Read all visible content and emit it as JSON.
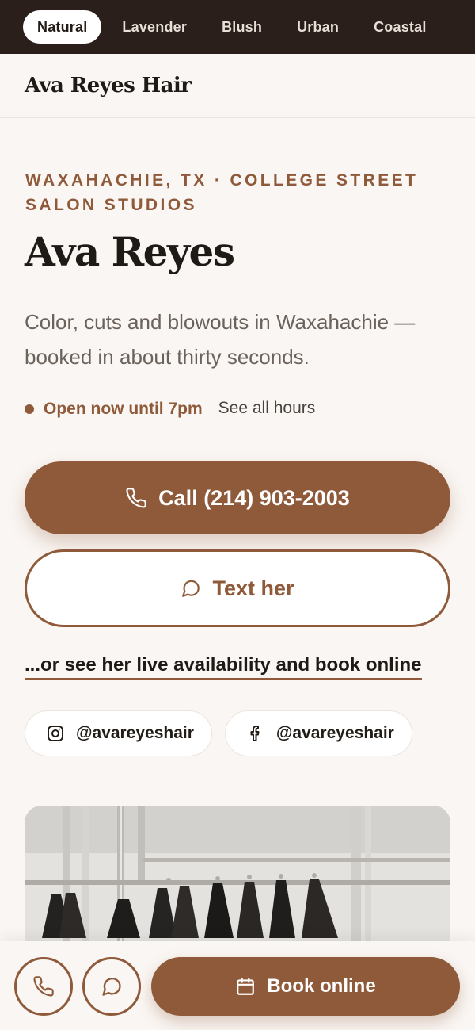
{
  "theme_bar": {
    "items": [
      {
        "label": "Natural",
        "active": true
      },
      {
        "label": "Lavender",
        "active": false
      },
      {
        "label": "Blush",
        "active": false
      },
      {
        "label": "Urban",
        "active": false
      },
      {
        "label": "Coastal",
        "active": false
      }
    ]
  },
  "header": {
    "brand": "Ava Reyes Hair"
  },
  "hero": {
    "eyebrow": "Waxahachie, TX · College Street Salon Studios",
    "title": "Ava Reyes",
    "subtitle": "Color, cuts and blowouts in Waxahachie — booked in about thirty seconds.",
    "status": "Open now until 7pm",
    "hours_link": "See all hours"
  },
  "actions": {
    "call_label": "Call (214) 903-2003",
    "text_label": "Text her",
    "book_link": "...or see her live availability and book online"
  },
  "social": {
    "instagram": "@avareyeshair",
    "facebook": "@avareyeshair"
  },
  "bottom_bar": {
    "book_label": "Book online"
  },
  "colors": {
    "accent": "#8f5a3a",
    "background": "#faf6f3",
    "topbar": "#2a1f1a"
  }
}
